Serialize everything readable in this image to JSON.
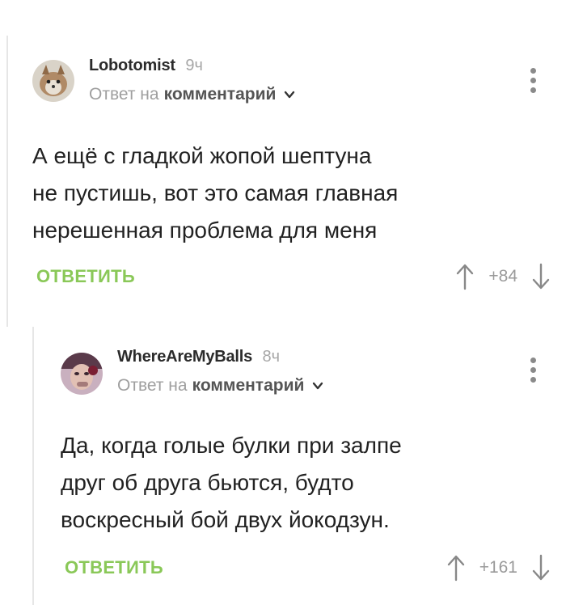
{
  "comments": [
    {
      "username": "Lobotomist",
      "time": "9ч",
      "reply_prefix": "Ответ на",
      "reply_target": "комментарий",
      "body_lines": [
        "А ещё с гладкой жопой шептуна",
        "не пустишь, вот это самая главная",
        "нерешенная проблема для меня"
      ],
      "reply_label": "ОТВЕТИТЬ",
      "score": "+84"
    },
    {
      "username": "WhereAreMyBalls",
      "time": "8ч",
      "reply_prefix": "Ответ на",
      "reply_target": "комментарий",
      "body_lines": [
        "Да, когда голые булки при залпе",
        "друг об друга бьются, будто",
        "воскресный бой двух йокодзун."
      ],
      "reply_label": "ОТВЕТИТЬ",
      "score": "+161"
    }
  ],
  "colors": {
    "accent": "#8ac858",
    "muted": "#9f9f9f",
    "text": "#222222"
  },
  "icons": {
    "more": "more-vertical-icon",
    "upvote": "arrow-up-icon",
    "downvote": "arrow-down-icon",
    "chevron": "chevron-down-icon"
  }
}
